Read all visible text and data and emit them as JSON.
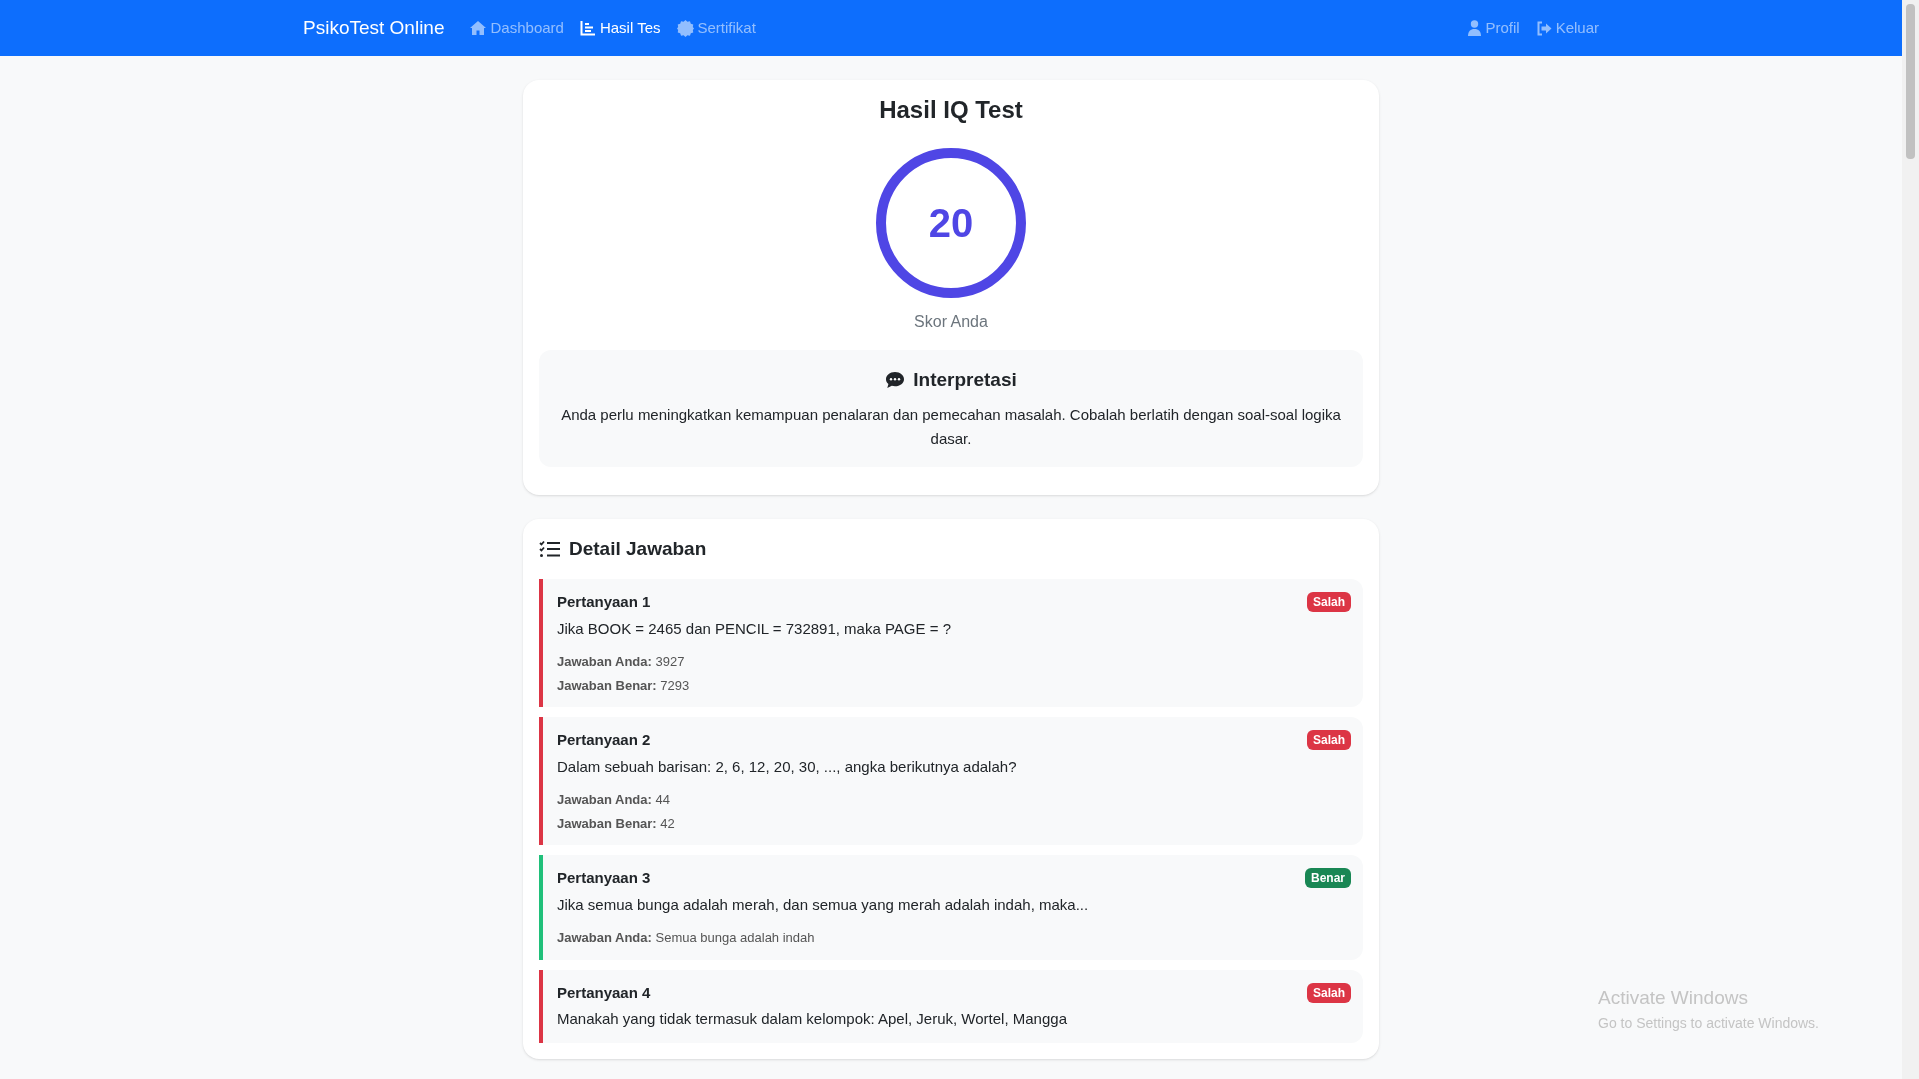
{
  "navbar": {
    "brand": "PsikoTest Online",
    "links": [
      {
        "label": "Dashboard",
        "kind": "home",
        "selected": false
      },
      {
        "label": "Hasil Tes",
        "kind": "chart",
        "selected": true
      },
      {
        "label": "Sertifikat",
        "kind": "certificate",
        "selected": false
      }
    ],
    "right_links": [
      {
        "label": "Profil",
        "kind": "user"
      },
      {
        "label": "Keluar",
        "kind": "logout"
      }
    ]
  },
  "result": {
    "title": "Hasil IQ Test",
    "score": "20",
    "score_label": "Skor Anda",
    "interpretation": {
      "title": "Interpretasi",
      "text": "Anda perlu meningkatkan kemampuan penalaran dan pemecahan masalah. Cobalah berlatih dengan soal-soal logika dasar."
    }
  },
  "details": {
    "title": "Detail Jawaban",
    "questions": [
      {
        "label": "Pertanyaan 1",
        "correct": false,
        "badge": "Salah",
        "question": "Jika BOOK = 2465 dan PENCIL = 732891, maka PAGE = ?",
        "answers": [
          {
            "label": "Jawaban Anda:",
            "value": "3927"
          },
          {
            "label": "Jawaban Benar:",
            "value": "7293"
          }
        ]
      },
      {
        "label": "Pertanyaan 2",
        "correct": false,
        "badge": "Salah",
        "question": "Dalam sebuah barisan: 2, 6, 12, 20, 30, ..., angka berikutnya adalah?",
        "answers": [
          {
            "label": "Jawaban Anda:",
            "value": "44"
          },
          {
            "label": "Jawaban Benar:",
            "value": "42"
          }
        ]
      },
      {
        "label": "Pertanyaan 3",
        "correct": true,
        "badge": "Benar",
        "question": "Jika semua bunga adalah merah, dan semua yang merah adalah indah, maka...",
        "answers": [
          {
            "label": "Jawaban Anda:",
            "value": "Semua bunga adalah indah"
          }
        ]
      },
      {
        "label": "Pertanyaan 4",
        "correct": false,
        "badge": "Salah",
        "question": "Manakah yang tidak termasuk dalam kelompok: Apel, Jeruk, Wortel, Mangga"
      }
    ]
  },
  "os_notice": {
    "title": "Activate Windows",
    "text": "Go to Settings to activate Windows."
  }
}
